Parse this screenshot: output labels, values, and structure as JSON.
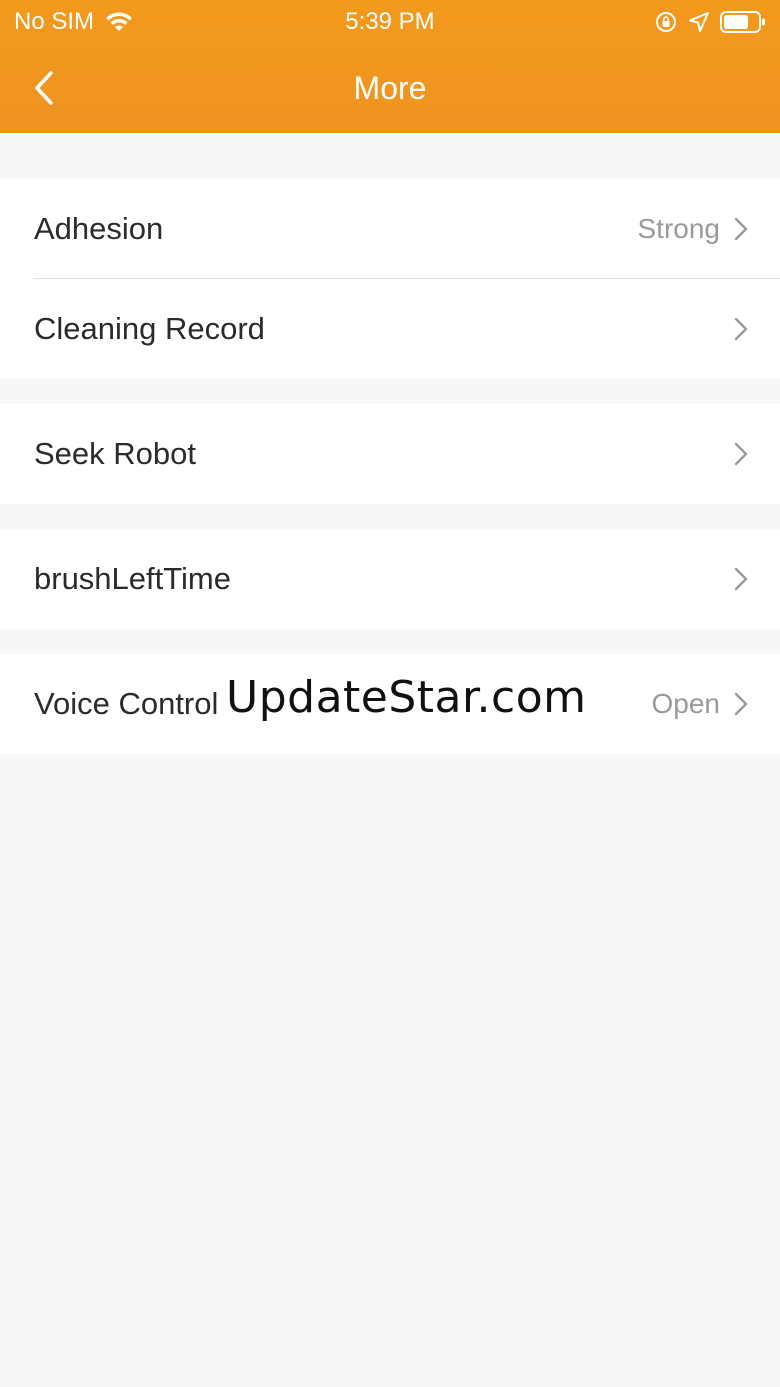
{
  "status_bar": {
    "carrier": "No SIM",
    "time": "5:39 PM",
    "icons": [
      "wifi-icon",
      "orientation-lock-icon",
      "location-icon",
      "battery-icon"
    ]
  },
  "nav": {
    "title": "More",
    "back_icon": "chevron-left-icon"
  },
  "groups": [
    {
      "rows": [
        {
          "label": "Adhesion",
          "value": "Strong"
        },
        {
          "label": "Cleaning Record",
          "value": ""
        }
      ]
    },
    {
      "rows": [
        {
          "label": "Seek Robot",
          "value": ""
        }
      ]
    },
    {
      "rows": [
        {
          "label": "brushLeftTime",
          "value": ""
        }
      ]
    },
    {
      "rows": [
        {
          "label": "Voice Control",
          "value": "Open"
        }
      ]
    }
  ],
  "watermark": "UpdateStar.com",
  "colors": {
    "header": "#f0961f",
    "background": "#f7f7f8",
    "row_background": "#ffffff",
    "label_text": "#2b2b2b",
    "value_text": "#9a9a9a",
    "chevron": "#9a9a9a"
  }
}
